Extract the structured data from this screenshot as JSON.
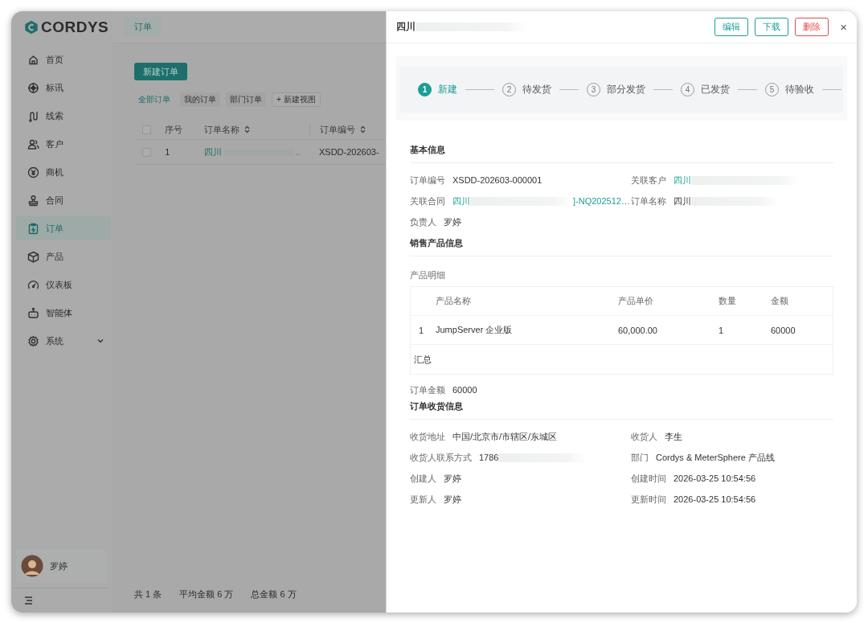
{
  "app": {
    "logo": "CORDYS",
    "top_tab": "订单"
  },
  "sidebar": {
    "items": [
      {
        "label": "首页",
        "selected": false
      },
      {
        "label": "标讯",
        "selected": false
      },
      {
        "label": "线索",
        "selected": false
      },
      {
        "label": "客户",
        "selected": false
      },
      {
        "label": "商机",
        "selected": false
      },
      {
        "label": "合同",
        "selected": false
      },
      {
        "label": "订单",
        "selected": true
      },
      {
        "label": "产品",
        "selected": false
      },
      {
        "label": "仪表板",
        "selected": false
      },
      {
        "label": "智能体",
        "selected": false
      },
      {
        "label": "系统",
        "selected": false,
        "expanded": false
      }
    ],
    "user": {
      "name": "罗婷"
    }
  },
  "orders": {
    "new_button": "新建订单",
    "views": [
      {
        "label": "全部订单",
        "selected": true
      },
      {
        "label": "我的订单",
        "selected": false
      },
      {
        "label": "部门订单",
        "selected": false
      }
    ],
    "add_view": "+ 新建视图",
    "table": {
      "all_checked": false,
      "columns": [
        "序号",
        "订单名称",
        "订单编号"
      ],
      "rows": [
        {
          "checked": false,
          "index": "1",
          "name": "四川",
          "name_tail": "..",
          "number": "XSDD-202603-"
        }
      ]
    },
    "footer": [
      "共 1 条",
      "平均金额 6 万",
      "总金额 6 万"
    ]
  },
  "drawer": {
    "title": "四川",
    "title_redacted": true,
    "actions": [
      {
        "label": "编辑",
        "kind": "default"
      },
      {
        "label": "下载",
        "kind": "default"
      },
      {
        "label": "删除",
        "kind": "danger"
      }
    ],
    "close": "×",
    "steps": [
      {
        "number": "1",
        "label": "新建",
        "selected": true
      },
      {
        "number": "2",
        "label": "待发货",
        "selected": false
      },
      {
        "number": "3",
        "label": "部分发货",
        "selected": false
      },
      {
        "number": "4",
        "label": "已发货",
        "selected": false
      },
      {
        "number": "5",
        "label": "待验收",
        "selected": false
      }
    ],
    "basic": {
      "title": "基本信息",
      "fields": [
        {
          "label": "订单编号",
          "value": "XSDD-202603-000001",
          "kind": "text",
          "redacted": false
        },
        {
          "label": "关联客户",
          "value": "四川",
          "kind": "link",
          "redacted": true
        },
        {
          "label": "关联合同",
          "value": "四川",
          "kind": "link",
          "redacted": true,
          "suffix": "]-NQ202512…"
        },
        {
          "label": "订单名称",
          "value": "四川",
          "kind": "text",
          "redacted": true
        },
        {
          "label": "负责人",
          "value": "罗婷",
          "kind": "text",
          "redacted": false
        }
      ]
    },
    "products": {
      "title": "销售产品信息",
      "subtitle": "产品明细",
      "columns": [
        "产品名称",
        "产品单价",
        "数量",
        "金额"
      ],
      "rows": [
        {
          "index": "1",
          "cells": [
            "JumpServer 企业版",
            "60,000.00",
            "1",
            "60000"
          ]
        }
      ],
      "summary": "汇总",
      "total": {
        "label": "订单金额",
        "value": "60000",
        "redacted": false
      }
    },
    "receipt": {
      "title": "订单收货信息",
      "fields": [
        {
          "label": "收货地址",
          "value": "中国/北京市/市辖区/东城区",
          "redacted": false
        },
        {
          "label": "收货人",
          "value": "李生",
          "redacted": false
        },
        {
          "label": "收货人联系方式",
          "value": "1786",
          "redacted": true
        },
        {
          "label": "部门",
          "value": "Cordys & MeterSphere 产品线",
          "redacted": false
        },
        {
          "label": "创建人",
          "value": "罗婷",
          "redacted": false
        },
        {
          "label": "创建时间",
          "value": "2026-03-25 10:54:56",
          "redacted": false
        },
        {
          "label": "更新人",
          "value": "罗婷",
          "redacted": false
        },
        {
          "label": "更新时间",
          "value": "2026-03-25 10:54:56",
          "redacted": false
        }
      ]
    }
  }
}
